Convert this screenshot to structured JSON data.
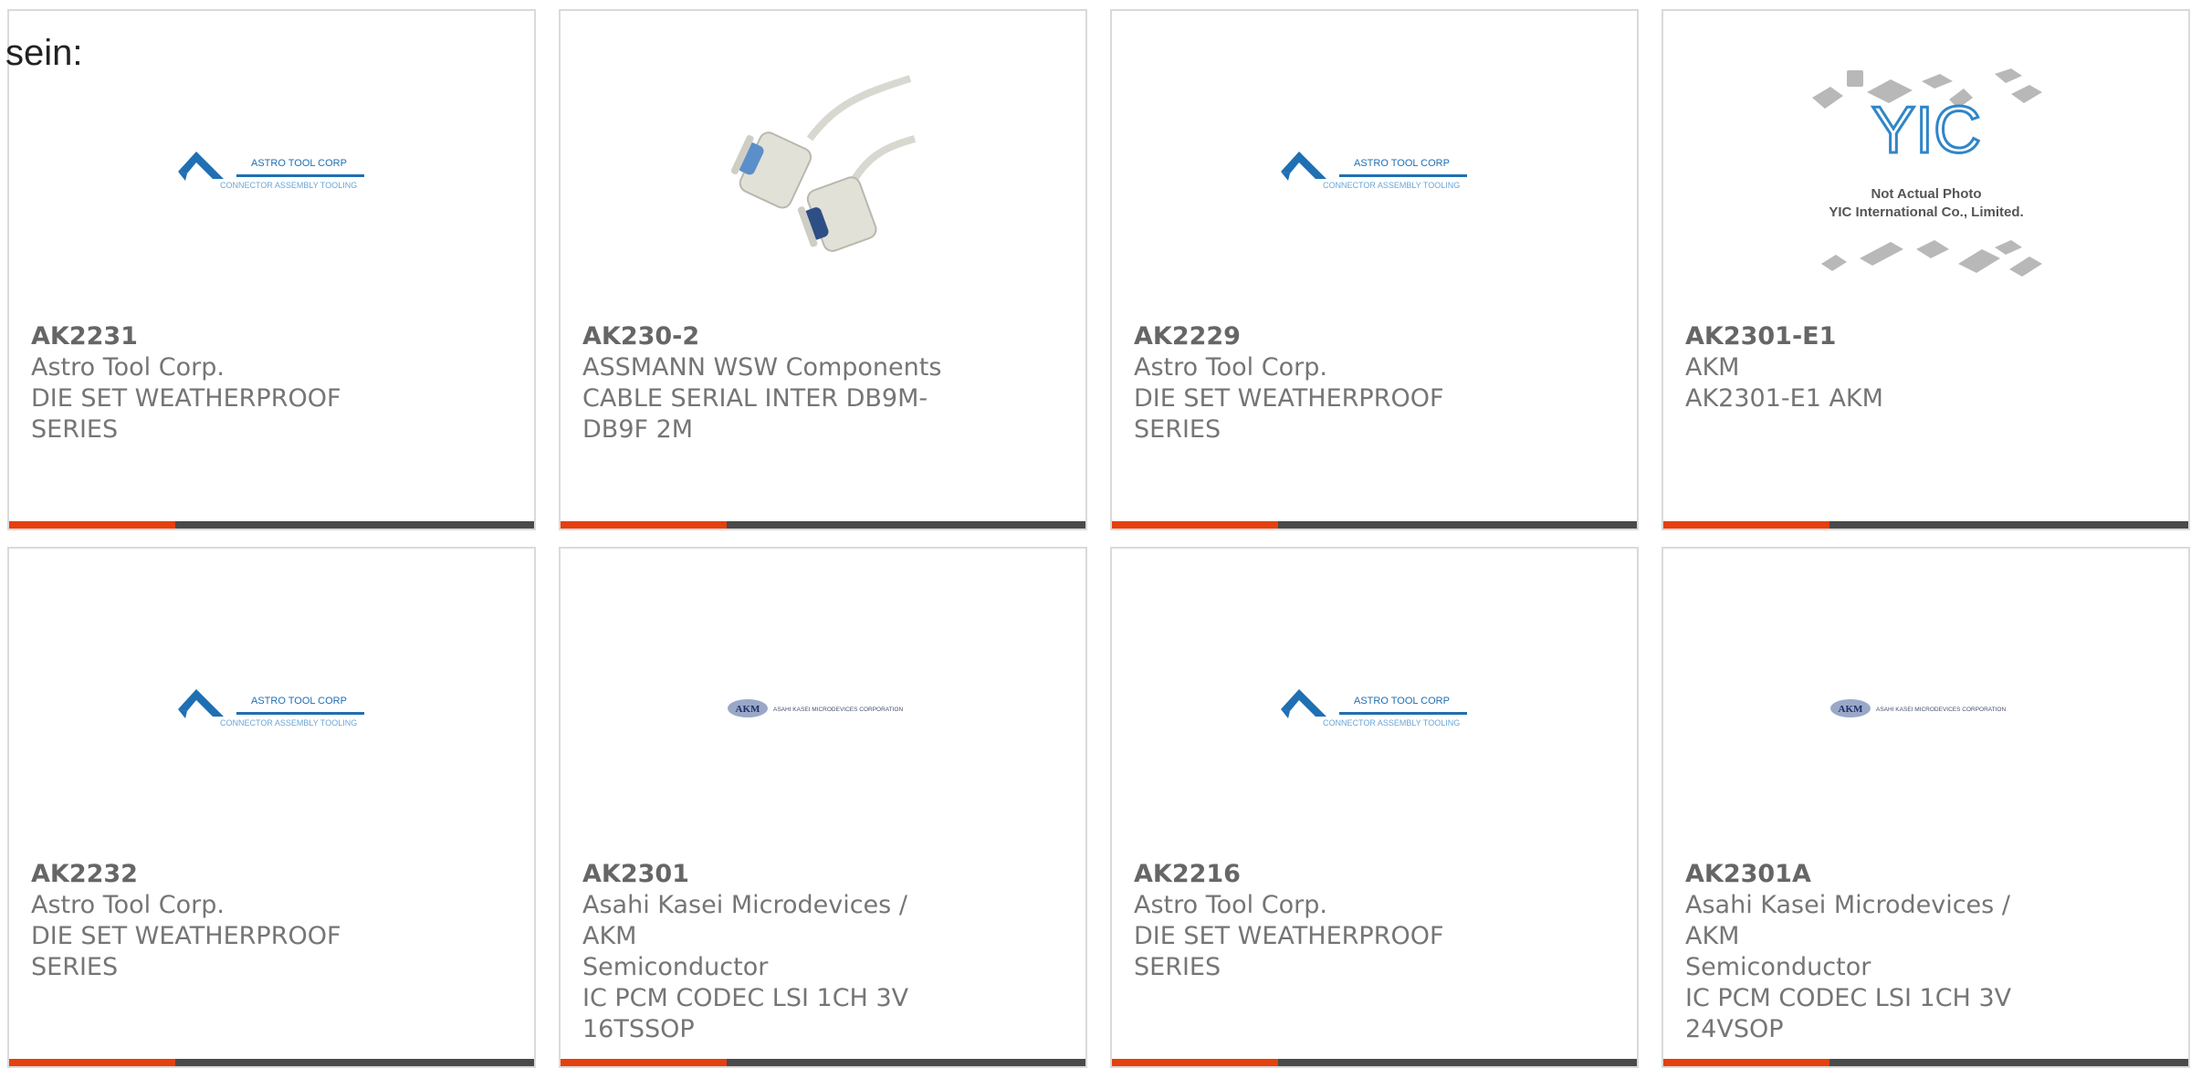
{
  "page": {
    "heading": "sein:"
  },
  "products": [
    {
      "part_number": "AK2231",
      "manufacturer": "Astro Tool Corp.",
      "desc1": "DIE SET WEATHERPROOF",
      "desc2": "SERIES",
      "desc3": "",
      "image": "astro-tool-logo",
      "logo_text": "ASTRO TOOL CORP",
      "logo_subtext": "CONNECTOR ASSEMBLY TOOLING"
    },
    {
      "part_number": "AK230-2",
      "manufacturer": "ASSMANN WSW Components",
      "desc1": "CABLE SERIAL INTER DB9M-",
      "desc2": "DB9F 2M",
      "desc3": "",
      "image": "serial-cable-photo"
    },
    {
      "part_number": "AK2229",
      "manufacturer": "Astro Tool Corp.",
      "desc1": "DIE SET WEATHERPROOF",
      "desc2": "SERIES",
      "desc3": "",
      "image": "astro-tool-logo",
      "logo_text": "ASTRO TOOL CORP",
      "logo_subtext": "CONNECTOR ASSEMBLY TOOLING"
    },
    {
      "part_number": "AK2301-E1",
      "manufacturer": "AKM",
      "desc1": "AK2301-E1 AKM",
      "desc2": "",
      "desc3": "",
      "image": "yic-placeholder",
      "placeholder_line1": "Not Actual Photo",
      "placeholder_line2": "YIC International Co., Limited."
    },
    {
      "part_number": "AK2232",
      "manufacturer": "Astro Tool Corp.",
      "desc1": "DIE SET WEATHERPROOF",
      "desc2": "SERIES",
      "desc3": "",
      "image": "astro-tool-logo",
      "logo_text": "ASTRO TOOL CORP",
      "logo_subtext": "CONNECTOR ASSEMBLY TOOLING"
    },
    {
      "part_number": "AK2301",
      "manufacturer": "Asahi Kasei Microdevices / AKM",
      "desc1": "Semiconductor",
      "desc2": "IC PCM CODEC LSI 1CH 3V",
      "desc3": "16TSSOP",
      "image": "akm-logo",
      "logo_text": "ASAHI KASEI MICRODEVICES CORPORATION"
    },
    {
      "part_number": "AK2216",
      "manufacturer": "Astro Tool Corp.",
      "desc1": "DIE SET WEATHERPROOF",
      "desc2": "SERIES",
      "desc3": "",
      "image": "astro-tool-logo",
      "logo_text": "ASTRO TOOL CORP",
      "logo_subtext": "CONNECTOR ASSEMBLY TOOLING"
    },
    {
      "part_number": "AK2301A",
      "manufacturer": "Asahi Kasei Microdevices / AKM",
      "desc1": "Semiconductor",
      "desc2": "IC PCM CODEC LSI 1CH 3V",
      "desc3": "24VSOP",
      "image": "akm-logo",
      "logo_text": "ASAHI KASEI MICRODEVICES CORPORATION"
    }
  ],
  "colors": {
    "accent": "#e5400d",
    "bar": "#4a4a4a",
    "astro_blue": "#1f6fb3",
    "akm_blue": "#6b7fb0"
  }
}
